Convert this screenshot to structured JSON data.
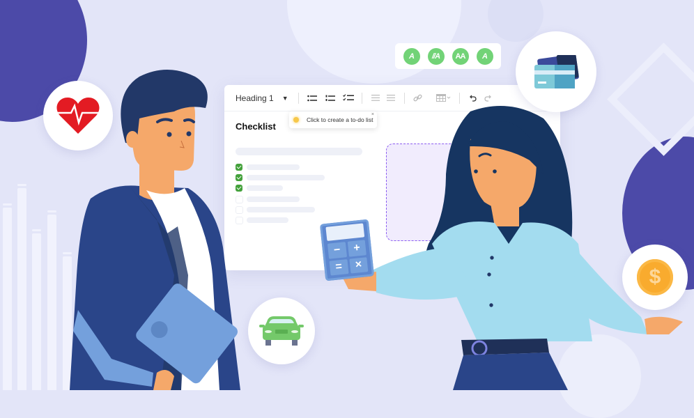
{
  "colors": {
    "background": "#e3e5f8",
    "accent_purple": "#4c4aa8",
    "check_green": "#43a13b",
    "font_chip_green": "#72d377",
    "dropzone_border": "#8c5df0",
    "heart_red": "#e31b23",
    "coin_orange": "#f9ab2e",
    "car_green": "#74c96a"
  },
  "editor": {
    "heading_select": "Heading 1",
    "toolbar_icons": [
      "bulleted-list-icon",
      "numbered-list-icon",
      "todo-list-icon",
      "align-left-icon",
      "align-right-icon",
      "link-icon",
      "table-icon",
      "undo-icon",
      "redo-icon"
    ],
    "tooltip": {
      "text": "Click to create a to-do list",
      "close": "×"
    },
    "title": "Checklist",
    "checklist": [
      {
        "checked": true
      },
      {
        "checked": true
      },
      {
        "checked": true
      },
      {
        "checked": false
      },
      {
        "checked": false
      },
      {
        "checked": false
      }
    ]
  },
  "font_chips": [
    "A",
    "//A",
    "AA",
    "A"
  ],
  "badges": {
    "heart": "heart-rate-icon",
    "car": "car-icon",
    "cards": "credit-card-icon",
    "coin": "$"
  },
  "calculator": {
    "keys": [
      "−",
      "+",
      "=",
      "×"
    ]
  }
}
